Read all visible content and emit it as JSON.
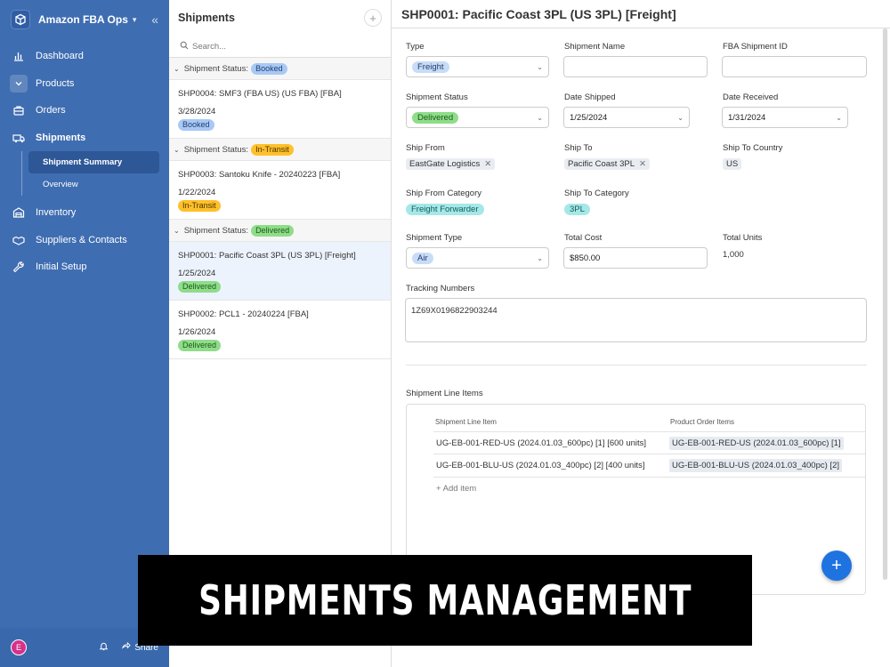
{
  "app": {
    "title": "Amazon FBA Ops"
  },
  "sidebar": {
    "items": [
      {
        "label": "Dashboard"
      },
      {
        "label": "Products"
      },
      {
        "label": "Orders"
      },
      {
        "label": "Shipments"
      },
      {
        "label": "Inventory"
      },
      {
        "label": "Suppliers & Contacts"
      },
      {
        "label": "Initial Setup"
      }
    ],
    "subitems": [
      {
        "label": "Shipment Summary"
      },
      {
        "label": "Overview"
      }
    ],
    "footer": {
      "avatar": "E",
      "share": "Share"
    }
  },
  "list": {
    "title": "Shipments",
    "search_placeholder": "Search...",
    "group_label": "Shipment Status:",
    "groups": [
      {
        "status": "Booked",
        "records": [
          {
            "title": "SHP0004: SMF3 (FBA US) (US FBA) [FBA]",
            "date": "3/28/2024",
            "badge": "Booked"
          }
        ]
      },
      {
        "status": "In-Transit",
        "records": [
          {
            "title": "SHP0003: Santoku Knife - 20240223 [FBA]",
            "date": "1/22/2024",
            "badge": "In-Transit"
          }
        ]
      },
      {
        "status": "Delivered",
        "records": [
          {
            "title": "SHP0001: Pacific Coast 3PL (US 3PL) [Freight]",
            "date": "1/25/2024",
            "badge": "Delivered"
          },
          {
            "title": "SHP0002: PCL1 - 20240224 [FBA]",
            "date": "1/26/2024",
            "badge": "Delivered"
          }
        ]
      }
    ]
  },
  "detail": {
    "title": "SHP0001: Pacific Coast 3PL (US 3PL) [Freight]",
    "labels": {
      "type": "Type",
      "shipment_name": "Shipment Name",
      "fba_id": "FBA Shipment ID",
      "status": "Shipment Status",
      "date_shipped": "Date Shipped",
      "date_received": "Date Received",
      "ship_from": "Ship From",
      "ship_to": "Ship To",
      "ship_to_country": "Ship To Country",
      "ship_from_category": "Ship From Category",
      "ship_to_category": "Ship To Category",
      "shipment_type": "Shipment Type",
      "total_cost": "Total Cost",
      "total_units": "Total Units",
      "tracking": "Tracking Numbers",
      "line_items": "Shipment Line Items"
    },
    "values": {
      "type": "Freight",
      "shipment_name": "",
      "fba_id": "",
      "status": "Delivered",
      "date_shipped": "1/25/2024",
      "date_received": "1/31/2024",
      "ship_from": "EastGate Logistics",
      "ship_to": "Pacific Coast 3PL",
      "ship_to_country": "US",
      "ship_from_category": "Freight Forwarder",
      "ship_to_category": "3PL",
      "shipment_type": "Air",
      "total_cost": "$850.00",
      "total_units": "1,000",
      "tracking": "1Z69X0196822903244"
    },
    "grid": {
      "headers": [
        "Shipment Line Item",
        "Product Order Items"
      ],
      "rows": [
        {
          "item": "UG-EB-001-RED-US (2024.01.03_600pc) [1] [600 units]",
          "order": "UG-EB-001-RED-US (2024.01.03_600pc) [1]"
        },
        {
          "item": "UG-EB-001-BLU-US (2024.01.03_400pc) [2] [400 units]",
          "order": "UG-EB-001-BLU-US (2024.01.03_400pc) [2]"
        }
      ],
      "add_label": "+ Add item"
    }
  },
  "banner": {
    "text": "SHIPMENTS MANAGEMENT"
  },
  "colors": {
    "sidebar": "#3f6db1",
    "accent": "#1f73e0",
    "booked": "#a9c9f5",
    "in_transit": "#ffc02a",
    "delivered": "#8fdc8a"
  }
}
